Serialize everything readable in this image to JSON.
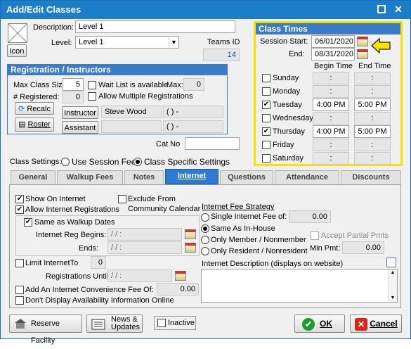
{
  "window": {
    "title": "Add/Edit Classes"
  },
  "header": {
    "icon_button": "Icon",
    "description_label": "Description:",
    "description_value": "Level 1",
    "level_label": "Level:",
    "level_value": "Level 1",
    "teams_id_label": "Teams ID",
    "teams_id_value": "14"
  },
  "registration": {
    "title": "Registration / Instructors",
    "max_class_size_label": "Max Class Size:",
    "max_class_size_value": "5",
    "registered_label": "# Registered:",
    "registered_value": "0",
    "waitlist_label": "Wait List is available",
    "max_label": "Max:",
    "max_value": "0",
    "allow_multiple_label": "Allow Multiple Registrations",
    "recalc_label": "Recalc",
    "roster_label": "Roster",
    "instructor_button": "Instructor",
    "instructor_value": "Steve Wood",
    "instructor_phone": "(   )   -",
    "assistant_button": "Assistant",
    "assistant_value": "",
    "assistant_phone": "(   )   -"
  },
  "cat_no_label": "Cat No",
  "cat_no_value": "",
  "class_times": {
    "title": "Class Times",
    "session_start_label": "Session Start:",
    "session_start_value": "06/01/2020",
    "end_label": "End:",
    "end_value": "08/31/2020",
    "begin_time_header": "Begin Time",
    "end_time_header": "End Time",
    "days": [
      {
        "name": "Sunday",
        "checked": false,
        "begin": ":",
        "end": ":"
      },
      {
        "name": "Monday",
        "checked": false,
        "begin": ":",
        "end": ":"
      },
      {
        "name": "Tuesday",
        "checked": true,
        "begin": "4:00 PM",
        "end": "5:00 PM"
      },
      {
        "name": "Wednesday",
        "checked": false,
        "begin": ":",
        "end": ":"
      },
      {
        "name": "Thursday",
        "checked": true,
        "begin": "4:00 PM",
        "end": "5:00 PM"
      },
      {
        "name": "Friday",
        "checked": false,
        "begin": ":",
        "end": ":"
      },
      {
        "name": "Saturday",
        "checked": false,
        "begin": ":",
        "end": ":"
      }
    ]
  },
  "class_settings": {
    "label": "Class Settings:",
    "use_session_fees": "Use Session Fees",
    "class_specific": "Class Specific Settings"
  },
  "tabs": [
    "General",
    "Walkup Fees",
    "Notes",
    "Internet",
    "Questions",
    "Attendance",
    "Discounts"
  ],
  "internet": {
    "show_on_internet": "Show On Internet",
    "allow_internet_registrations": "Allow Internet Registrations",
    "exclude_from_calendar_1": "Exclude From",
    "exclude_from_calendar_2": "Community Calendar",
    "same_as_walkup_dates": "Same as Walkup Dates",
    "reg_begins_label": "Internet Reg Begins:",
    "reg_begins_value": "  /  /          :",
    "ends_label": "Ends:",
    "ends_value": "  /  /          :",
    "limit_label": "Limit InternetTo",
    "limit_value": "0",
    "reg_until_label": "Registrations Until:",
    "reg_until_value": "  /  /          :",
    "convenience_fee_label": "Add An Internet Convenience Fee Of:",
    "convenience_fee_value": "0.00",
    "dont_display_label": "Don't Display Availability Information Online",
    "fee_strategy_title": "Internet Fee Strategy",
    "single_fee_label": "Single Internet Fee of:",
    "single_fee_value": "0.00",
    "same_as_inhouse": "Same As In-House",
    "only_member": "Only Member / Nonmember",
    "only_resident": "Only Resident / Nonresident",
    "accept_partial": "Accept Partial Pmts",
    "min_pmt_label": "Min Pmt:",
    "min_pmt_value": "0.00",
    "description_label": "Internet Description  (displays on website)",
    "description_value": ""
  },
  "footer": {
    "reserve_facility": "Reserve Facility",
    "news_updates_1": "News &",
    "news_updates_2": "Updates",
    "inactive": "Inactive",
    "ok": "OK",
    "cancel": "Cancel"
  },
  "colors": {
    "title_bar": "#1c7dc8",
    "section_header": "#3a7cc8",
    "highlight_border": "#f2e300",
    "arrow": "#f5e400"
  }
}
